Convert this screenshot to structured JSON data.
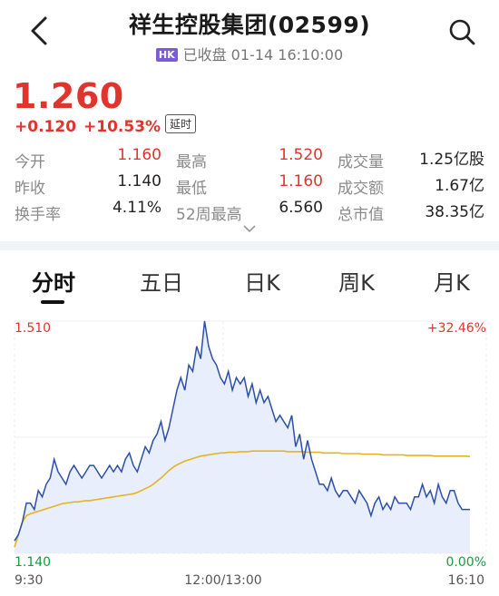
{
  "header": {
    "title": "祥生控股集团(02599)",
    "market_badge": "HK",
    "status": "已收盘 01-14 16:10:00"
  },
  "quote": {
    "price": "1.260",
    "change": "+0.120",
    "change_pct": "+10.53%",
    "delay_badge": "延时",
    "accent_color": "#e0342c"
  },
  "stats": [
    {
      "label": "今开",
      "value": "1.160",
      "color": "red"
    },
    {
      "label": "最高",
      "value": "1.520",
      "color": "red"
    },
    {
      "label": "成交量",
      "value": "1.25亿股",
      "color": "normal"
    },
    {
      "label": "昨收",
      "value": "1.140",
      "color": "normal"
    },
    {
      "label": "最低",
      "value": "1.160",
      "color": "red"
    },
    {
      "label": "成交额",
      "value": "1.67亿",
      "color": "normal"
    },
    {
      "label": "换手率",
      "value": "4.11%",
      "color": "normal"
    },
    {
      "label": "52周最高",
      "value": "6.560",
      "color": "normal"
    },
    {
      "label": "总市值",
      "value": "38.35亿",
      "color": "normal"
    }
  ],
  "tabs": [
    {
      "label": "分时",
      "active": true
    },
    {
      "label": "五日",
      "active": false
    },
    {
      "label": "日K",
      "active": false
    },
    {
      "label": "周K",
      "active": false
    },
    {
      "label": "月K",
      "active": false
    }
  ],
  "chart": {
    "max_label": "1.510",
    "min_label": "1.140",
    "max_pct_label": "+32.46%",
    "min_pct_label": "0.00%",
    "time_start": "9:30",
    "time_mid": "12:00/13:00",
    "time_end": "16:10",
    "line_color": "#2c4fa8",
    "avg_color": "#e6b422",
    "fill_color": "#e8eefb"
  },
  "chart_data": {
    "type": "line",
    "ylim": [
      1.14,
      1.51
    ],
    "x_ticks": [
      "9:30",
      "12:00/13:00",
      "16:10"
    ],
    "series": [
      {
        "values": [
          1.16,
          1.17,
          1.19,
          1.22,
          1.22,
          1.21,
          1.24,
          1.23,
          1.25,
          1.26,
          1.29,
          1.27,
          1.26,
          1.25,
          1.27,
          1.28,
          1.27,
          1.26,
          1.27,
          1.28,
          1.28,
          1.27,
          1.26,
          1.27,
          1.28,
          1.27,
          1.28,
          1.27,
          1.29,
          1.3,
          1.28,
          1.27,
          1.29,
          1.31,
          1.3,
          1.32,
          1.33,
          1.35,
          1.32,
          1.34,
          1.37,
          1.4,
          1.42,
          1.4,
          1.44,
          1.43,
          1.47,
          1.45,
          1.51,
          1.47,
          1.45,
          1.44,
          1.42,
          1.41,
          1.43,
          1.4,
          1.42,
          1.41,
          1.42,
          1.39,
          1.41,
          1.38,
          1.4,
          1.38,
          1.39,
          1.37,
          1.35,
          1.36,
          1.35,
          1.34,
          1.36,
          1.31,
          1.33,
          1.29,
          1.32,
          1.29,
          1.27,
          1.25,
          1.25,
          1.24,
          1.26,
          1.24,
          1.23,
          1.24,
          1.24,
          1.23,
          1.22,
          1.24,
          1.23,
          1.22,
          1.2,
          1.22,
          1.23,
          1.21,
          1.22,
          1.21,
          1.23,
          1.22,
          1.22,
          1.22,
          1.21,
          1.23,
          1.23,
          1.25,
          1.23,
          1.24,
          1.22,
          1.25,
          1.23,
          1.22,
          1.24,
          1.24,
          1.22,
          1.21,
          1.21,
          1.21
        ]
      },
      {
        "values": [
          1.15,
          1.17,
          1.19,
          1.2,
          1.203,
          1.205,
          1.207,
          1.209,
          1.211,
          1.213,
          1.215,
          1.217,
          1.219,
          1.22,
          1.221,
          1.222,
          1.222,
          1.223,
          1.224,
          1.224,
          1.225,
          1.226,
          1.227,
          1.228,
          1.229,
          1.23,
          1.231,
          1.232,
          1.233,
          1.234,
          1.235,
          1.237,
          1.24,
          1.243,
          1.246,
          1.25,
          1.255,
          1.26,
          1.266,
          1.272,
          1.277,
          1.281,
          1.284,
          1.287,
          1.289,
          1.291,
          1.293,
          1.295,
          1.296,
          1.297,
          1.298,
          1.299,
          1.3,
          1.3,
          1.301,
          1.301,
          1.301,
          1.302,
          1.302,
          1.302,
          1.303,
          1.303,
          1.303,
          1.303,
          1.303,
          1.303,
          1.303,
          1.303,
          1.303,
          1.302,
          1.302,
          1.302,
          1.302,
          1.302,
          1.301,
          1.301,
          1.301,
          1.301,
          1.3,
          1.3,
          1.3,
          1.3,
          1.3,
          1.299,
          1.299,
          1.299,
          1.299,
          1.299,
          1.298,
          1.298,
          1.298,
          1.298,
          1.298,
          1.297,
          1.297,
          1.297,
          1.297,
          1.297,
          1.297,
          1.296,
          1.296,
          1.296,
          1.296,
          1.296,
          1.296,
          1.296,
          1.295,
          1.295,
          1.295,
          1.295,
          1.295,
          1.295,
          1.295,
          1.295,
          1.295,
          1.294
        ]
      }
    ]
  }
}
